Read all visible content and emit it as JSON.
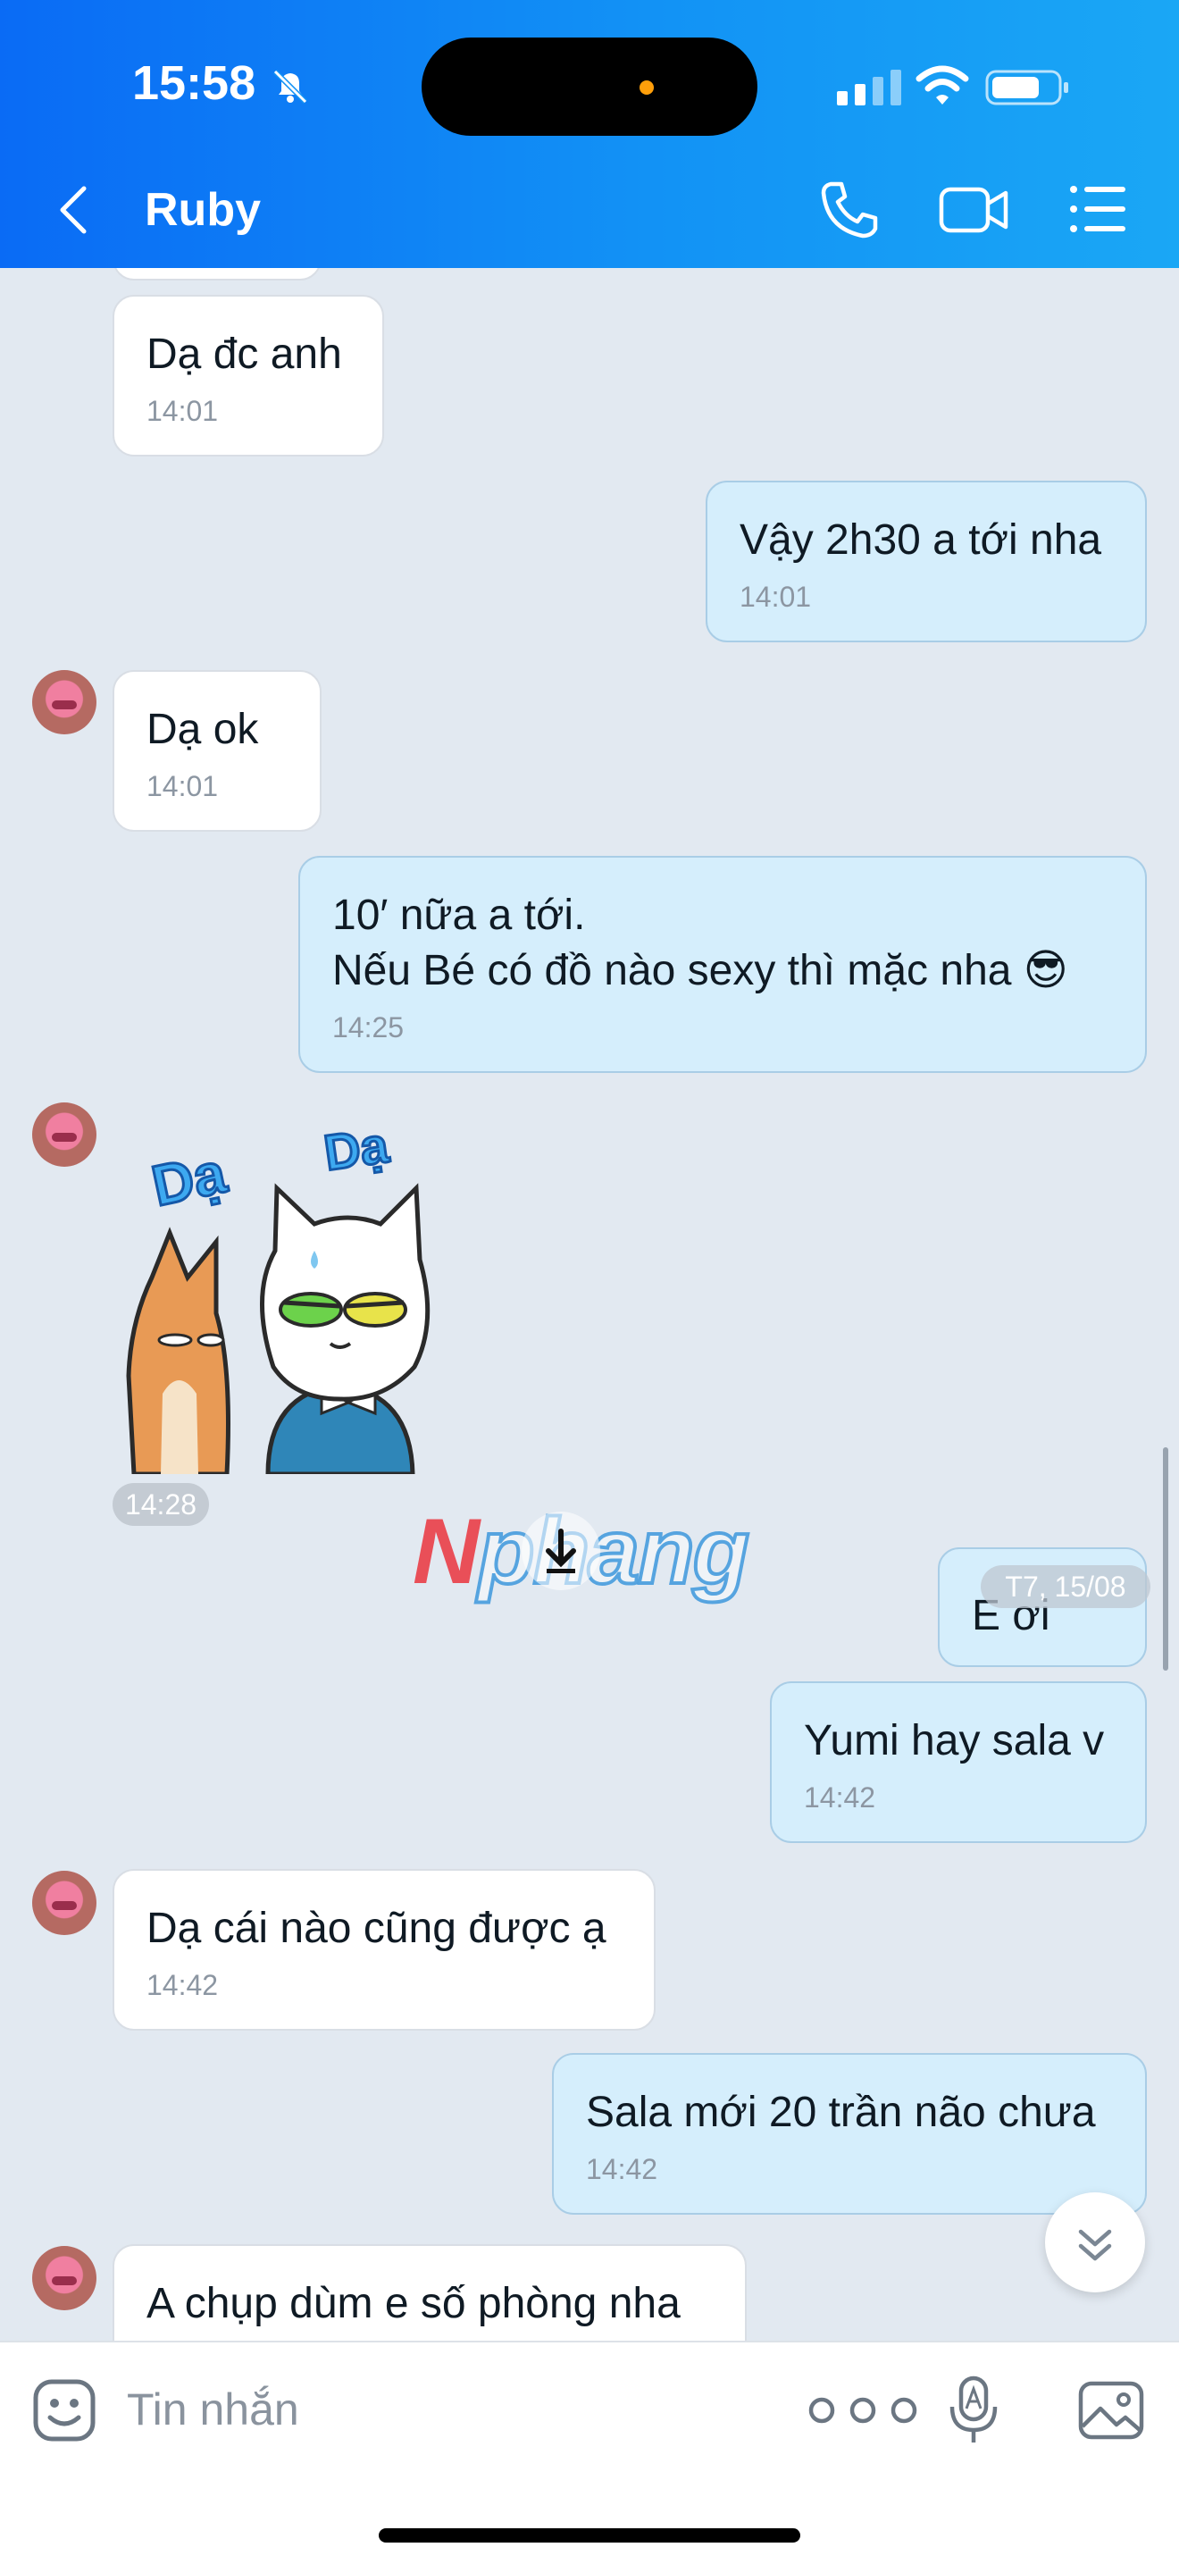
{
  "status_bar": {
    "time": "15:58"
  },
  "header": {
    "contact_name": "Ruby"
  },
  "messages": [
    {
      "text": "Dạ đc anh",
      "time": "14:01"
    },
    {
      "text": "Vậy 2h30 a tới nha",
      "time": "14:01"
    },
    {
      "text": "Dạ ok",
      "time": "14:01"
    },
    {
      "text": "10′ nữa a tới.\nNếu Bé có đồ nào sexy thì mặc nha 😎",
      "time": "14:25"
    },
    {
      "time": "14:28",
      "sticker_text_left": "Dạ",
      "sticker_text_right": "Dạ"
    },
    {
      "text": "E ơi"
    },
    {
      "text": "Yumi hay sala v",
      "time": "14:42"
    },
    {
      "text": "Dạ cái nào cũng được ạ",
      "time": "14:42"
    },
    {
      "text": "Sala mới 20 trần não chưa",
      "time": "14:42"
    },
    {
      "text": "A chụp dùm e số phòng nha"
    }
  ],
  "date_separator": "T7, 15/08",
  "watermark": {
    "first": "N",
    "rest": "phang"
  },
  "composer": {
    "placeholder": "Tin nhắn"
  },
  "colors": {
    "header_start": "#0A6BF5",
    "header_end": "#1AA7F5",
    "outgoing_bubble": "#D5EEFC",
    "incoming_bubble": "#FFFFFF",
    "chat_background": "#E2E9F1"
  },
  "icons": [
    "bell-off-icon",
    "back-chevron-icon",
    "phone-icon",
    "video-camera-icon",
    "list-menu-icon",
    "sticker-emoji-icon",
    "more-dots-icon",
    "voice-mic-icon",
    "image-gallery-icon",
    "scroll-down-icon",
    "download-icon"
  ]
}
